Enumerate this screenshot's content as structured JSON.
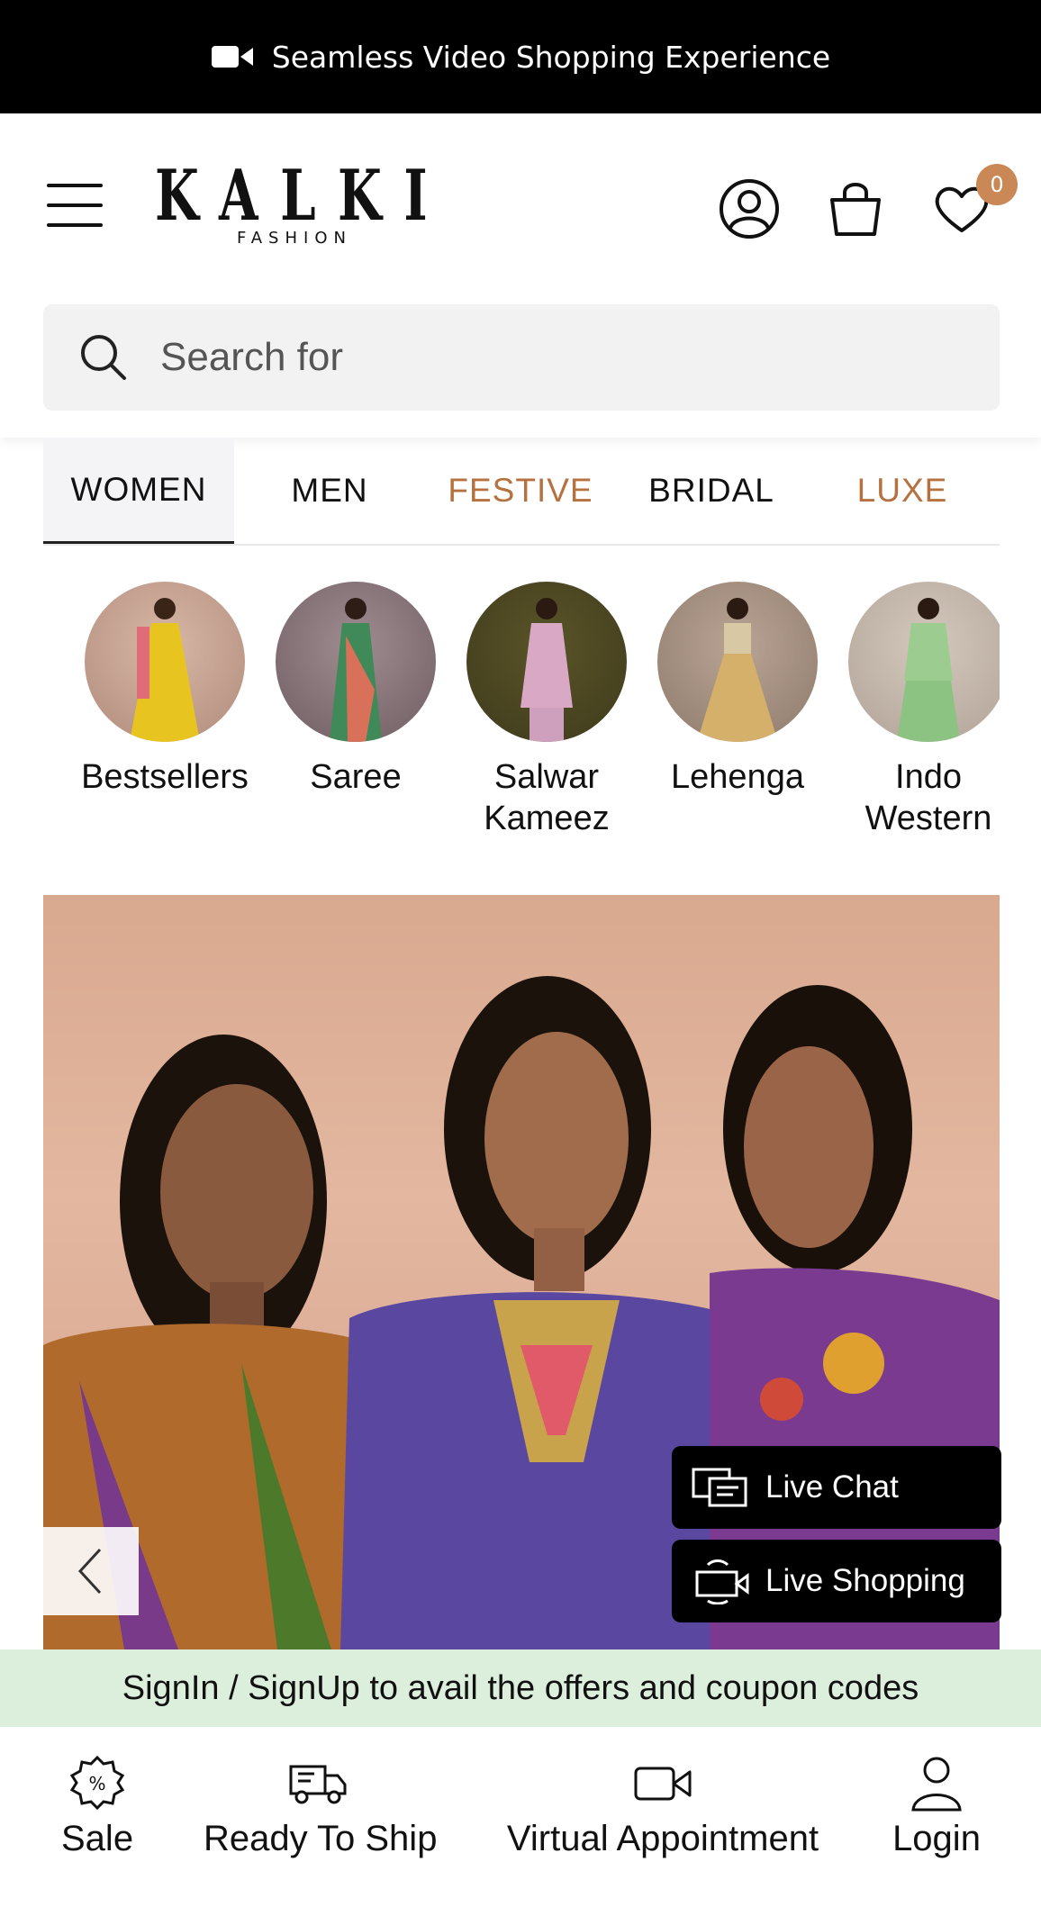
{
  "announcement": {
    "text": "Seamless Video Shopping Experience",
    "icon": "video-camera-icon"
  },
  "header": {
    "brand": "KALKI",
    "brand_sub": "FASHION",
    "wishlist_count": "0"
  },
  "search": {
    "placeholder": "Search for"
  },
  "tabs": [
    {
      "label": "WOMEN",
      "active": true
    },
    {
      "label": "MEN"
    },
    {
      "label": "FESTIVE",
      "accent": true
    },
    {
      "label": "BRIDAL"
    },
    {
      "label": "LUXE",
      "accent": true
    }
  ],
  "categories": [
    {
      "label": "Bestsellers"
    },
    {
      "label": "Saree"
    },
    {
      "label": "Salwar Kameez"
    },
    {
      "label": "Lehenga"
    },
    {
      "label": "Indo Western"
    }
  ],
  "floating": {
    "live_chat": "Live Chat",
    "live_shopping": "Live Shopping"
  },
  "promo": {
    "text": "SignIn / SignUp to avail the offers and coupon codes"
  },
  "bottom_nav": [
    {
      "label": "Sale",
      "icon": "sale-badge-icon"
    },
    {
      "label": "Ready To Ship",
      "icon": "delivery-truck-icon"
    },
    {
      "label": "Virtual Appointment",
      "icon": "video-camera-icon"
    },
    {
      "label": "Login",
      "icon": "user-icon"
    }
  ],
  "colors": {
    "accent": "#b5713f",
    "badge": "#c98855",
    "promo_bg": "#dcefdc"
  }
}
